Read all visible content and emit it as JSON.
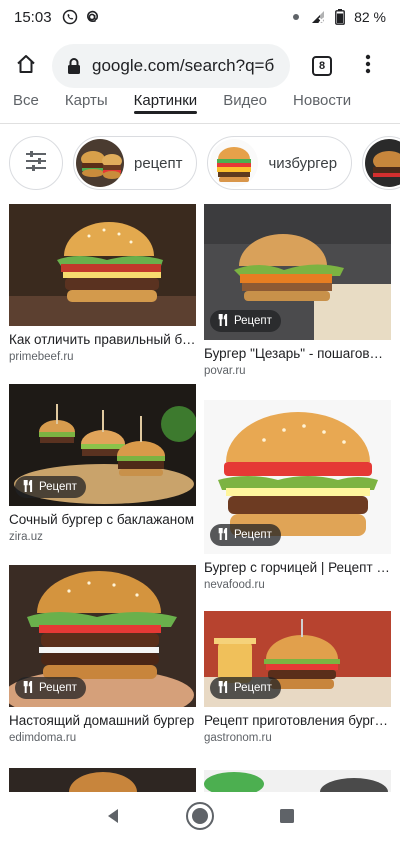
{
  "status_bar": {
    "time": "15:03",
    "battery": "82 %",
    "icons": [
      "whatsapp-icon",
      "email-icon",
      "dot-icon",
      "signal-icon",
      "battery-icon"
    ]
  },
  "browser": {
    "url": "google.com/search?q=б",
    "tab_count": "8",
    "icons": [
      "home-icon",
      "lock-icon",
      "tabs-icon",
      "more-vert-icon"
    ]
  },
  "search_tabs": [
    {
      "label": "Все",
      "active": false
    },
    {
      "label": "Карты",
      "active": false
    },
    {
      "label": "Картинки",
      "active": true
    },
    {
      "label": "Видео",
      "active": false
    },
    {
      "label": "Новости",
      "active": false
    }
  ],
  "chips": [
    {
      "label": "рецепт"
    },
    {
      "label": "чизбургер"
    }
  ],
  "badge_label": "Рецепт",
  "results": [
    {
      "title": "Как отличить правильный бургер",
      "source": "primebeef.ru",
      "badge": false
    },
    {
      "title": "Бургер \"Цезарь\" - пошаговый рецепт",
      "source": "povar.ru",
      "badge": true
    },
    {
      "title": "Сочный бургер с баклажаном",
      "source": "zira.uz",
      "badge": true
    },
    {
      "title": "Бургер с горчицей | Рецепт бургера",
      "source": "nevafood.ru",
      "badge": true
    },
    {
      "title": "Настоящий домашний бургер",
      "source": "edimdoma.ru",
      "badge": true
    },
    {
      "title": "Рецепт приготовления бургера",
      "source": "gastronom.ru",
      "badge": true
    }
  ],
  "colors": {
    "background": "#ffffff",
    "text": "#202124",
    "muted": "#5f6368",
    "urlbar": "#f1f3f4"
  },
  "nav_icons": [
    "back-icon",
    "home-circle-icon",
    "recents-icon"
  ]
}
